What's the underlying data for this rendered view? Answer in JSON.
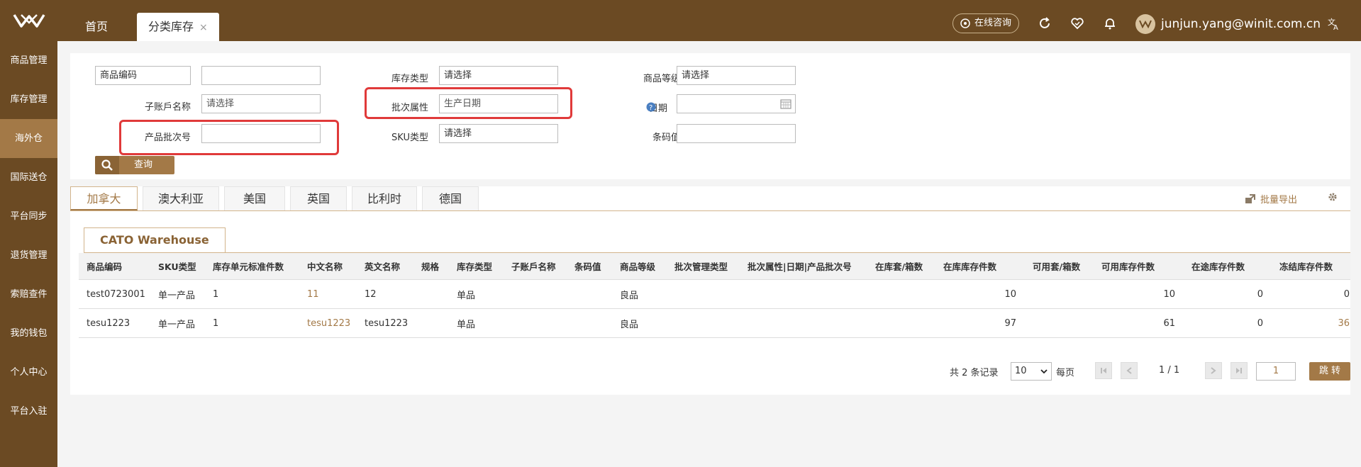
{
  "topbar": {
    "home_tab": "首页",
    "active_tab": "分类库存",
    "close_symbol": "×",
    "consult_label": "在线咨询",
    "user_email": "junjun.yang@winit.com.cn"
  },
  "sidebar": {
    "items": [
      {
        "label": "商品管理"
      },
      {
        "label": "库存管理"
      },
      {
        "label": "海外仓"
      },
      {
        "label": "国际送仓"
      },
      {
        "label": "平台同步"
      },
      {
        "label": "退货管理"
      },
      {
        "label": "索赔查件"
      },
      {
        "label": "我的钱包"
      },
      {
        "label": "个人中心"
      },
      {
        "label": "平台入驻"
      }
    ],
    "active_index": 2
  },
  "filter": {
    "code_type_value": "商品编码",
    "sub_account_label": "子账戶名称",
    "sub_account_value": "请选择",
    "batch_no_label": "产品批次号",
    "stock_type_label": "库存类型",
    "stock_type_value": "请选择",
    "batch_attr_label": "批次属性",
    "batch_attr_value": "生产日期",
    "sku_type_label": "SKU类型",
    "sku_type_value": "请选择",
    "grade_label": "商品等级",
    "grade_value": "请选择",
    "date_label": "日期",
    "barcode_label": "条码值",
    "query_button": "查询"
  },
  "country_tabs": [
    "加拿大",
    "澳大利亚",
    "美国",
    "英国",
    "比利时",
    "德国"
  ],
  "export_label": "批量导出",
  "warehouse_tab": "CATO Warehouse",
  "table": {
    "headers": [
      "商品编码",
      "SKU类型",
      "库存单元标准件数",
      "中文名称",
      "英文名称",
      "规格",
      "库存类型",
      "子账戶名称",
      "条码值",
      "商品等级",
      "批次管理类型",
      "批次属性|日期|产品批次号",
      "在库套/箱数",
      "在库库存件数",
      "可用套/箱数",
      "可用库存件数",
      "在途库存件数",
      "冻结库存件数"
    ],
    "rows": [
      {
        "code": "test0723001",
        "sku_type": "单一产品",
        "std_qty": "1",
        "cn_name": "11",
        "en_name": "12",
        "spec": "",
        "stock_type": "单品",
        "sub_account": "",
        "barcode": "",
        "grade": "良品",
        "batch_type": "",
        "batch_attr": "",
        "in_sets": "",
        "in_qty": "10",
        "avail_sets": "",
        "avail_qty": "10",
        "transit_qty": "0",
        "frozen_qty": "0"
      },
      {
        "code": "tesu1223",
        "sku_type": "单一产品",
        "std_qty": "1",
        "cn_name": "tesu1223",
        "en_name": "tesu1223",
        "spec": "",
        "stock_type": "单品",
        "sub_account": "",
        "barcode": "",
        "grade": "良品",
        "batch_type": "",
        "batch_attr": "",
        "in_sets": "",
        "in_qty": "97",
        "avail_sets": "",
        "avail_qty": "61",
        "transit_qty": "0",
        "frozen_qty": "36"
      }
    ]
  },
  "pager": {
    "total_text": "共 2 条记录",
    "page_size": "10",
    "per_page_label": "每页",
    "page_info": "1 / 1",
    "page_input": "1",
    "jump_label": "跳 转"
  },
  "colors": {
    "brand": "#6b4a23",
    "accent": "#a37947",
    "highlight": "#e03a3a"
  }
}
